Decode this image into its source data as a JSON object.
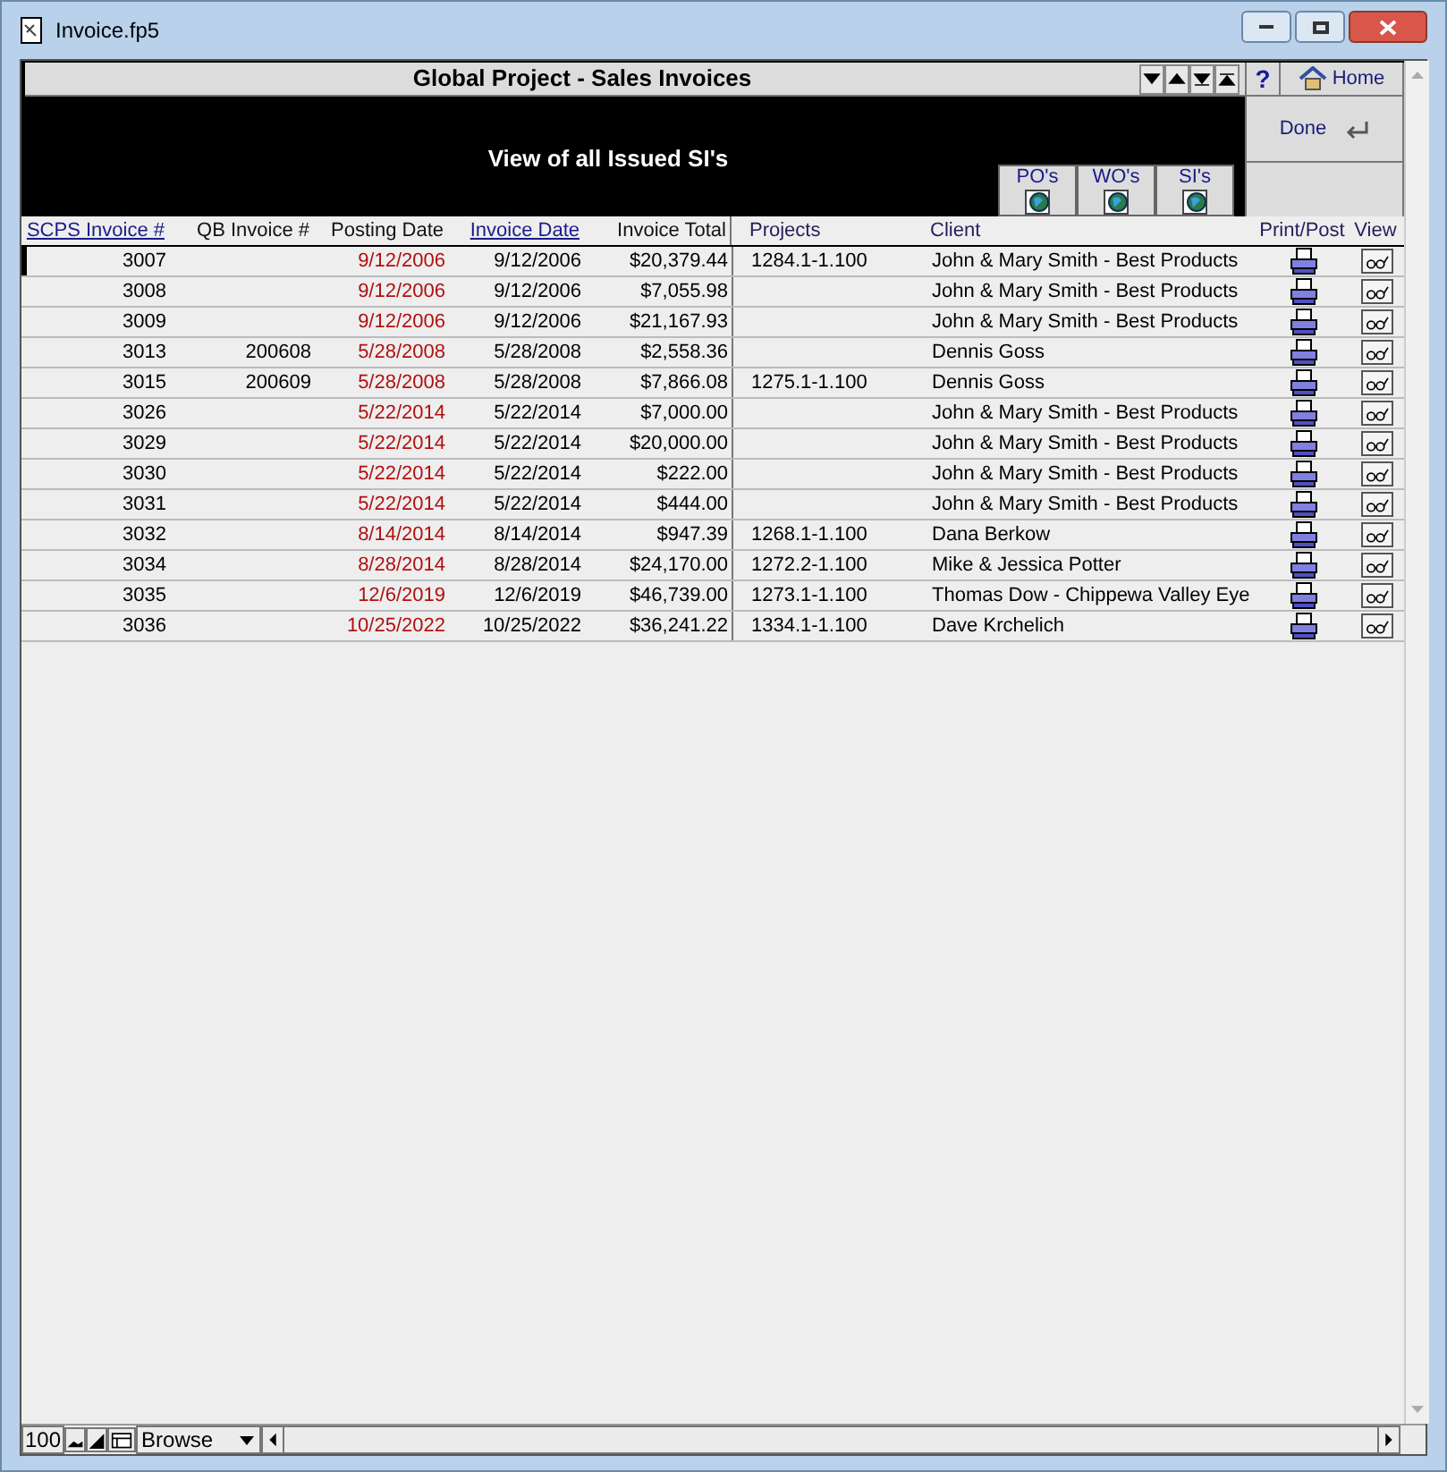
{
  "window": {
    "title": "Invoice.fp5"
  },
  "header": {
    "title": "Global Project - Sales Invoices",
    "help": "?",
    "home_button": "Home",
    "subtitle": "View of all Issued SI's",
    "done_button": "Done"
  },
  "nav_buttons": [
    "PO's",
    "WO's",
    "SI's"
  ],
  "table": {
    "columns": [
      {
        "label": "SCPS Invoice #",
        "sortable": true
      },
      {
        "label": "QB Invoice #",
        "sortable": false
      },
      {
        "label": "Posting Date",
        "sortable": false
      },
      {
        "label": "Invoice Date",
        "sortable": true
      },
      {
        "label": "Invoice Total",
        "sortable": false
      },
      {
        "label": "Projects",
        "sortable": false
      },
      {
        "label": "Client",
        "sortable": false
      },
      {
        "label": "Print/Post",
        "sortable": false
      },
      {
        "label": "View",
        "sortable": false
      }
    ],
    "rows": [
      {
        "invoice": "3007",
        "qb_invoice": "",
        "posting_date": "9/12/2006",
        "invoice_date": "9/12/2006",
        "total": "$20,379.44",
        "project": "1284.1-1.100",
        "client": "John & Mary Smith - Best Products",
        "selected": true
      },
      {
        "invoice": "3008",
        "qb_invoice": "",
        "posting_date": "9/12/2006",
        "invoice_date": "9/12/2006",
        "total": "$7,055.98",
        "project": "",
        "client": "John & Mary Smith - Best Products",
        "selected": false
      },
      {
        "invoice": "3009",
        "qb_invoice": "",
        "posting_date": "9/12/2006",
        "invoice_date": "9/12/2006",
        "total": "$21,167.93",
        "project": "",
        "client": "John & Mary Smith - Best Products",
        "selected": false
      },
      {
        "invoice": "3013",
        "qb_invoice": "200608",
        "posting_date": "5/28/2008",
        "invoice_date": "5/28/2008",
        "total": "$2,558.36",
        "project": "",
        "client": "Dennis Goss",
        "selected": false
      },
      {
        "invoice": "3015",
        "qb_invoice": "200609",
        "posting_date": "5/28/2008",
        "invoice_date": "5/28/2008",
        "total": "$7,866.08",
        "project": "1275.1-1.100",
        "client": "Dennis Goss",
        "selected": false
      },
      {
        "invoice": "3026",
        "qb_invoice": "",
        "posting_date": "5/22/2014",
        "invoice_date": "5/22/2014",
        "total": "$7,000.00",
        "project": "",
        "client": "John & Mary Smith - Best Products",
        "selected": false
      },
      {
        "invoice": "3029",
        "qb_invoice": "",
        "posting_date": "5/22/2014",
        "invoice_date": "5/22/2014",
        "total": "$20,000.00",
        "project": "",
        "client": "John & Mary Smith - Best Products",
        "selected": false
      },
      {
        "invoice": "3030",
        "qb_invoice": "",
        "posting_date": "5/22/2014",
        "invoice_date": "5/22/2014",
        "total": "$222.00",
        "project": "",
        "client": "John & Mary Smith - Best Products",
        "selected": false
      },
      {
        "invoice": "3031",
        "qb_invoice": "",
        "posting_date": "5/22/2014",
        "invoice_date": "5/22/2014",
        "total": "$444.00",
        "project": "",
        "client": "John & Mary Smith - Best Products",
        "selected": false
      },
      {
        "invoice": "3032",
        "qb_invoice": "",
        "posting_date": "8/14/2014",
        "invoice_date": "8/14/2014",
        "total": "$947.39",
        "project": "1268.1-1.100",
        "client": "Dana Berkow",
        "selected": false
      },
      {
        "invoice": "3034",
        "qb_invoice": "",
        "posting_date": "8/28/2014",
        "invoice_date": "8/28/2014",
        "total": "$24,170.00",
        "project": "1272.2-1.100",
        "client": "Mike & Jessica Potter",
        "selected": false
      },
      {
        "invoice": "3035",
        "qb_invoice": "",
        "posting_date": "12/6/2019",
        "invoice_date": "12/6/2019",
        "total": "$46,739.00",
        "project": "1273.1-1.100",
        "client": "Thomas Dow - Chippewa Valley Eye",
        "selected": false
      },
      {
        "invoice": "3036",
        "qb_invoice": "",
        "posting_date": "10/25/2022",
        "invoice_date": "10/25/2022",
        "total": "$36,241.22",
        "project": "1334.1-1.100",
        "client": "Dave Krchelich",
        "selected": false
      }
    ]
  },
  "status_bar": {
    "zoom": "100",
    "mode": "Browse"
  }
}
